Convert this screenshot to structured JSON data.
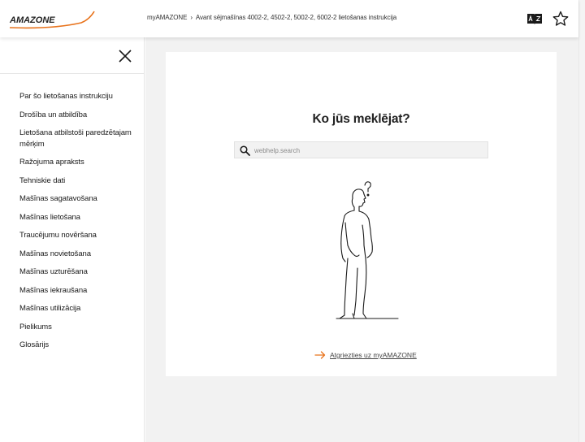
{
  "header": {
    "logo_text": "AMAZONE",
    "breadcrumb": [
      "myAMAZONE",
      "Avant sējmašīnas 4002-2, 4502-2, 5002-2, 6002-2 lietošanas instrukcija"
    ],
    "breadcrumb_separator": "›"
  },
  "sidebar": {
    "items": [
      "Par šo lietošanas instrukciju",
      "Drošība un atbildība",
      "Lietošana atbilstoši paredzētajam mērķim",
      "Ražojuma apraksts",
      "Tehniskie dati",
      "Mašīnas sagatavošana",
      "Mašīnas lietošana",
      "Traucējumu novēršana",
      "Mašīnas novietošana",
      "Mašīnas uzturēšana",
      "Mašīnas iekraušana",
      "Mašīnas utilizācija",
      "Pielikums",
      "Glosārijs"
    ]
  },
  "main": {
    "title": "Ko jūs meklējat?",
    "search_placeholder": "webhelp.search",
    "search_value": "",
    "back_link": "Atgriezties uz myAMAZONE"
  },
  "icons": {
    "glossary": "a-z-book-icon",
    "favorite": "star-icon",
    "close": "close-icon",
    "search": "search-icon",
    "back": "arrow-right-icon"
  },
  "colors": {
    "brand_orange": "#e8731c",
    "text_dark": "#222222",
    "background_gray": "#f2f2f2"
  }
}
